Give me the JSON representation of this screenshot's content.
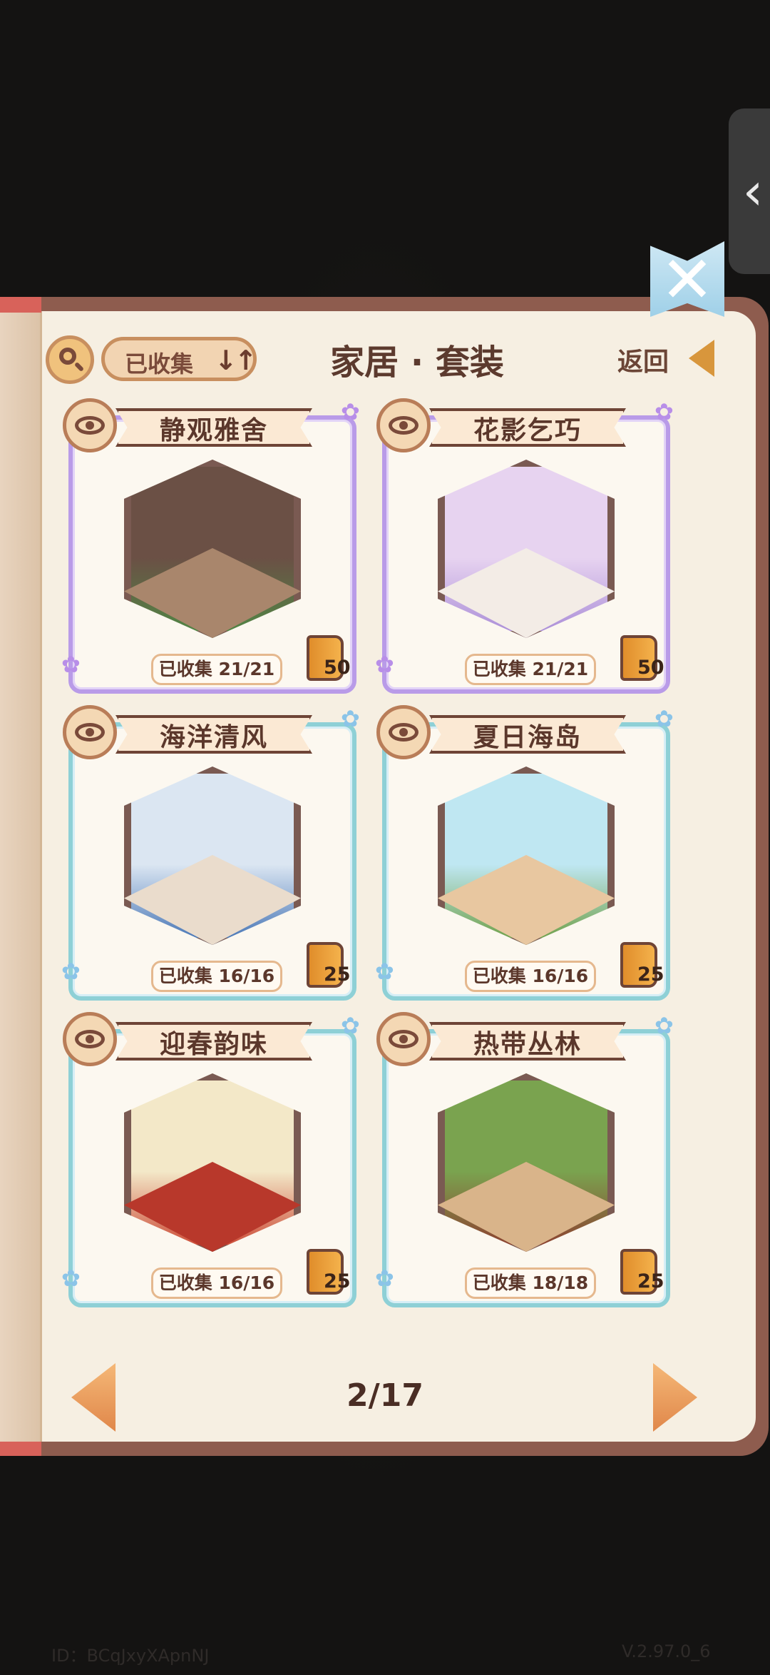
{
  "header": {
    "filter_label": "已收集",
    "sort_glyph": "↓↑",
    "title": "家居 · 套装",
    "back_label": "返回"
  },
  "cards": [
    {
      "name": "静观雅舍",
      "collected": "已收集 21/21",
      "reward": "50",
      "frame": "purple",
      "wall": "#6b5045",
      "floor": "#a9866c",
      "accent": "#4f8a45"
    },
    {
      "name": "花影乞巧",
      "collected": "已收集 21/21",
      "reward": "50",
      "frame": "purple",
      "wall": "#e7d3f0",
      "floor": "#f3ece6",
      "accent": "#a78ad6"
    },
    {
      "name": "海洋清风",
      "collected": "已收集 16/16",
      "reward": "25",
      "frame": "teal",
      "wall": "#dbe6f2",
      "floor": "#eadccc",
      "accent": "#3f6fb2"
    },
    {
      "name": "夏日海岛",
      "collected": "已收集 16/16",
      "reward": "25",
      "frame": "teal",
      "wall": "#bfe7f2",
      "floor": "#e8c7a0",
      "accent": "#6a9c3e"
    },
    {
      "name": "迎春韵味",
      "collected": "已收集 16/16",
      "reward": "25",
      "frame": "teal",
      "wall": "#f3e8c8",
      "floor": "#b8382b",
      "accent": "#c9412d"
    },
    {
      "name": "热带丛林",
      "collected": "已收集 18/18",
      "reward": "25",
      "frame": "teal",
      "wall": "#7aa34f",
      "floor": "#d9b48a",
      "accent": "#8e3a2e"
    }
  ],
  "pagination": {
    "current": "2/17"
  },
  "footer": {
    "id_text": "ID：BCqJxyXApnNJ",
    "version": "V.2.97.0_6"
  },
  "icons": {
    "search": "search-icon",
    "sort": "sort-icon",
    "eye": "eye-icon",
    "back": "back-arrow-icon",
    "close": "close-icon",
    "reward": "book-reward-icon"
  }
}
